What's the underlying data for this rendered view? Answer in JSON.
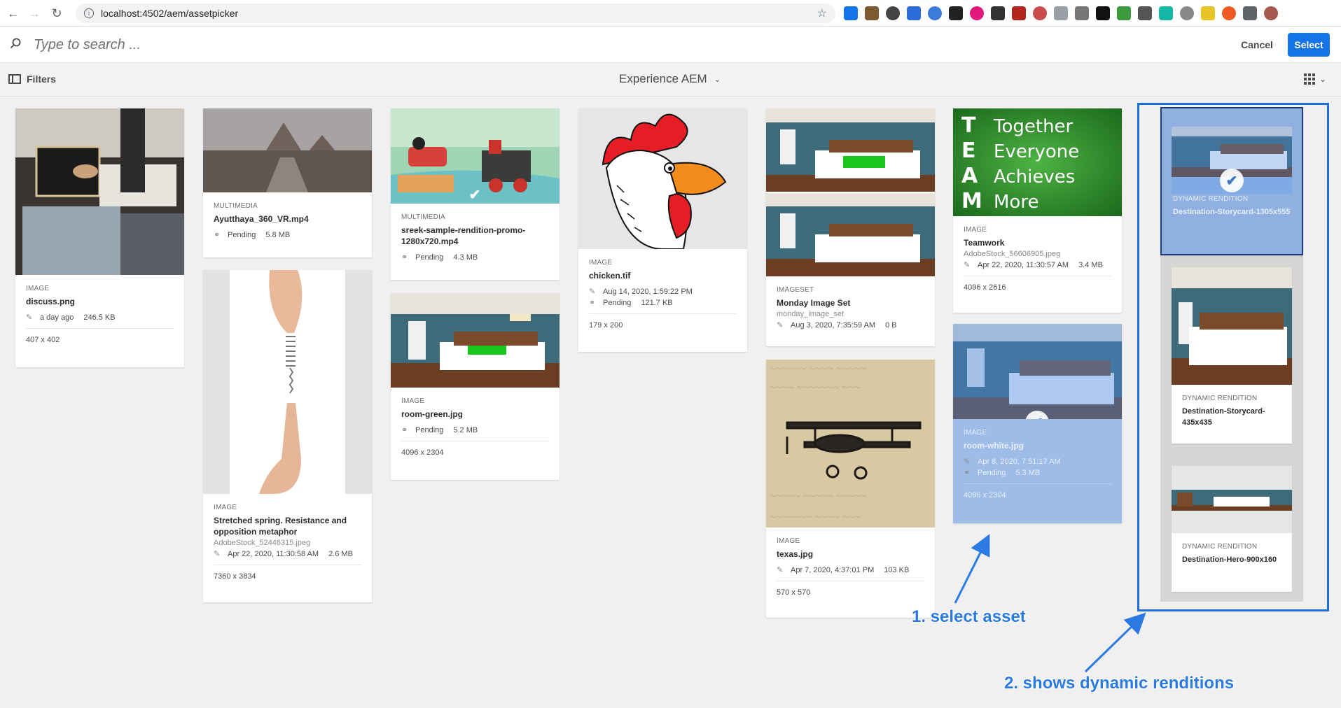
{
  "browser": {
    "url": "localhost:4502/aem/assetpicker"
  },
  "search": {
    "placeholder": "Type to search ...",
    "cancel_label": "Cancel",
    "select_label": "Select"
  },
  "toolbar": {
    "filters_label": "Filters",
    "folder": "Experience AEM"
  },
  "assets": [
    {
      "type": "IMAGE",
      "title": "discuss.png",
      "row1": "a day ago",
      "size": "246.5 KB",
      "dim": "407 x 402"
    },
    {
      "type": "MULTIMEDIA",
      "title": "Ayutthaya_360_VR.mp4",
      "status": "Pending",
      "size": "5.8 MB"
    },
    {
      "type": "IMAGE",
      "title": "Stretched spring. Resistance and opposition metaphor",
      "sub": "AdobeStock_52446315.jpeg",
      "date": "Apr 22, 2020, 11:30:58 AM",
      "size": "2.6 MB",
      "dim": "7360 x 3834"
    },
    {
      "type": "MULTIMEDIA",
      "title": "sreek-sample-rendition-promo-1280x720.mp4",
      "status": "Pending",
      "size": "4.3 MB"
    },
    {
      "type": "IMAGE",
      "title": "room-green.jpg",
      "status": "Pending",
      "size": "5.2 MB",
      "dim": "4096 x 2304"
    },
    {
      "type": "IMAGE",
      "title": "chicken.tif",
      "date": "Aug 14, 2020, 1:59:22 PM",
      "status": "Pending",
      "size": "121.7 KB",
      "dim": "179 x 200"
    },
    {
      "type": "IMAGESET",
      "title": "Monday Image Set",
      "sub": "monday_image_set",
      "date": "Aug 3, 2020, 7:35:59 AM",
      "size": "0 B"
    },
    {
      "type": "IMAGE",
      "title": "texas.jpg",
      "date": "Apr 7, 2020, 4:37:01 PM",
      "size": "103 KB",
      "dim": "570 x 570"
    },
    {
      "type": "IMAGE",
      "title": "Teamwork",
      "sub": "AdobeStock_56606905.jpeg",
      "date": "Apr 22, 2020, 11:30:57 AM",
      "size": "3.4 MB",
      "dim": "4096 x 2616"
    },
    {
      "type": "IMAGE",
      "title": "room-white.jpg",
      "date": "Apr 8, 2020, 7:51:17 AM",
      "status": "Pending",
      "size": "5.3 MB",
      "dim": "4096 x 2304"
    }
  ],
  "teamwork_board": [
    "Together",
    "Everyone",
    "Achieves",
    "More"
  ],
  "teamwork_initials": [
    "T",
    "E",
    "A",
    "M"
  ],
  "renditions": [
    {
      "type": "DYNAMIC RENDITION",
      "title": "Destination-Storycard-1305x555"
    },
    {
      "type": "DYNAMIC RENDITION",
      "title": "Destination-Storycard-435x435"
    },
    {
      "type": "DYNAMIC RENDITION",
      "title": "Destination-Hero-900x160"
    }
  ],
  "annotations": {
    "step1": "1. select asset",
    "step2": "2. shows dynamic renditions"
  }
}
